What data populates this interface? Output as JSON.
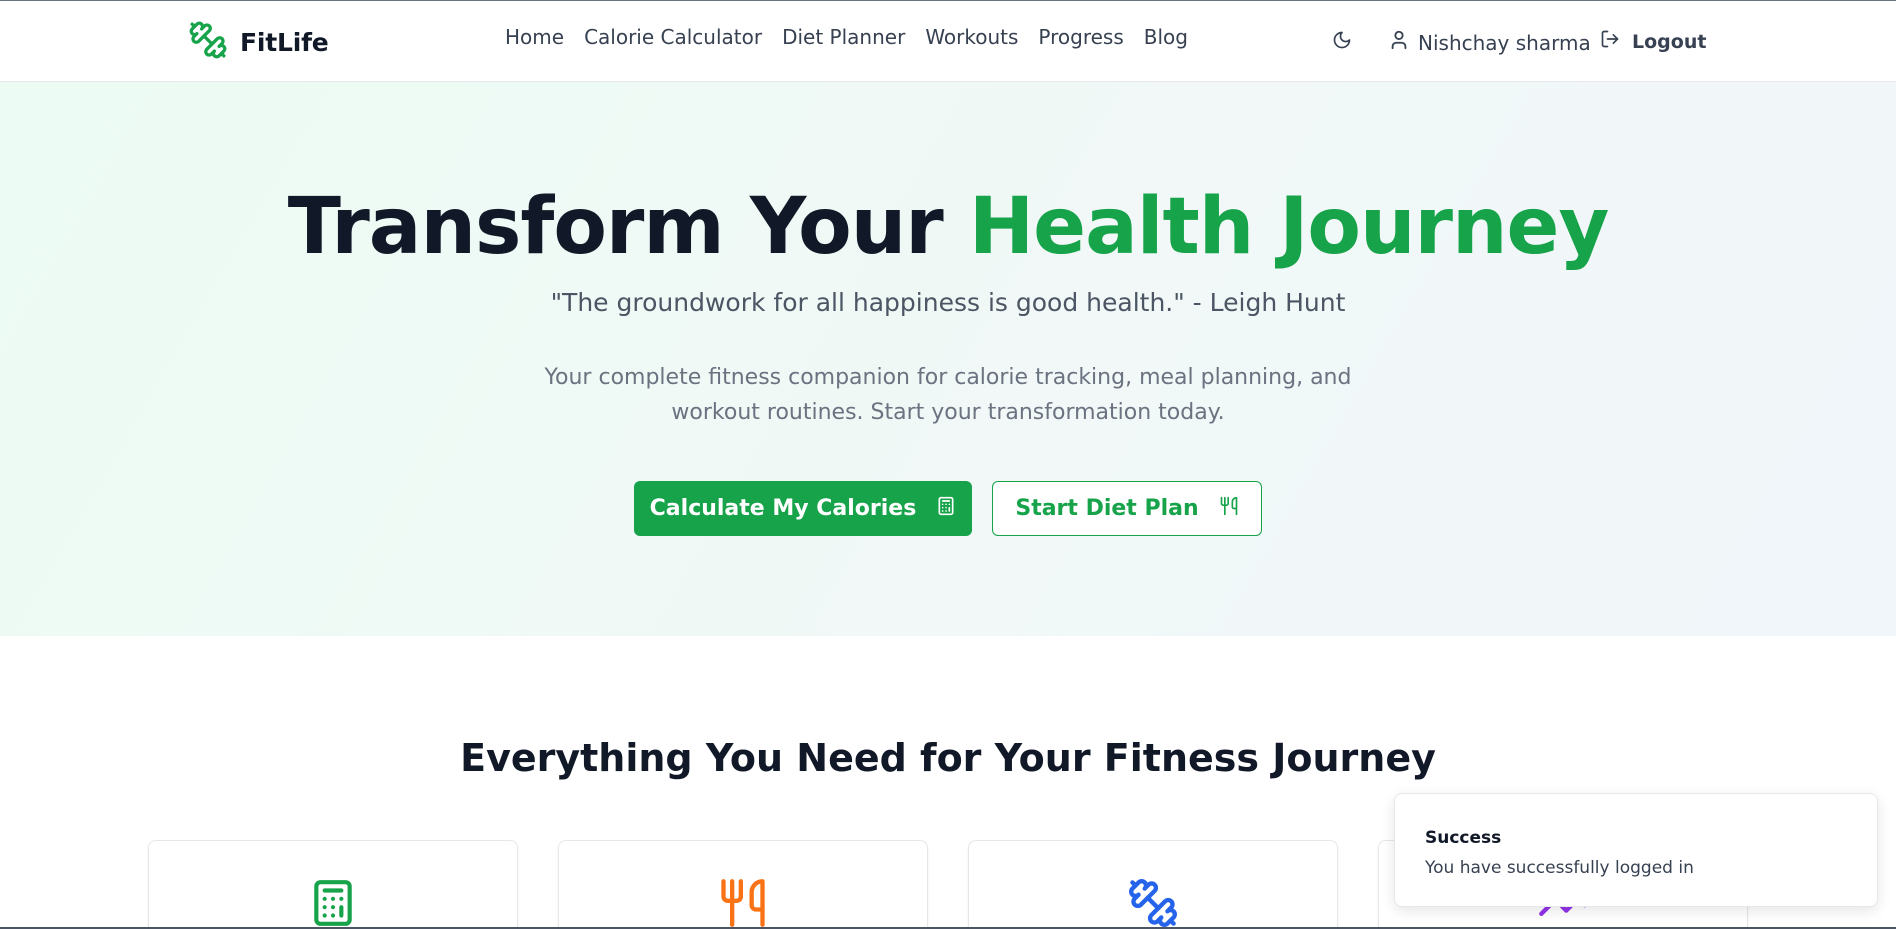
{
  "brand": {
    "name": "FitLife",
    "icon": "dumbbell-icon",
    "color": "#16a34a"
  },
  "nav": {
    "links": [
      {
        "label": "Home"
      },
      {
        "label": "Calorie Calculator"
      },
      {
        "label": "Diet Planner"
      },
      {
        "label": "Workouts"
      },
      {
        "label": "Progress"
      },
      {
        "label": "Blog"
      }
    ],
    "theme_icon": "moon-icon",
    "user_name": "Nishchay sharma",
    "user_icon": "user-icon",
    "logout_label": "Logout",
    "logout_icon": "logout-icon"
  },
  "hero": {
    "title_part1": "Transform Your ",
    "title_part2": "Health Journey",
    "quote": "\"The groundwork for all happiness is good health.\" - Leigh Hunt",
    "description": "Your complete fitness companion for calorie tracking, meal planning, and workout routines. Start your transformation today.",
    "primary_button": {
      "label": "Calculate My Calories",
      "icon": "calculator-icon"
    },
    "secondary_button": {
      "label": "Start Diet Plan",
      "icon": "utensils-icon"
    },
    "accent_color": "#16a34a"
  },
  "features": {
    "title": "Everything You Need for Your Fitness Journey",
    "cards": [
      {
        "icon": "calculator-icon",
        "color": "#16a34a"
      },
      {
        "icon": "utensils-icon",
        "color": "#f97316"
      },
      {
        "icon": "dumbbell-icon",
        "color": "#2563eb"
      },
      {
        "icon": "trend-icon",
        "color": "#9333ea"
      }
    ]
  },
  "toast": {
    "title": "Success",
    "message": "You have successfully logged in"
  }
}
